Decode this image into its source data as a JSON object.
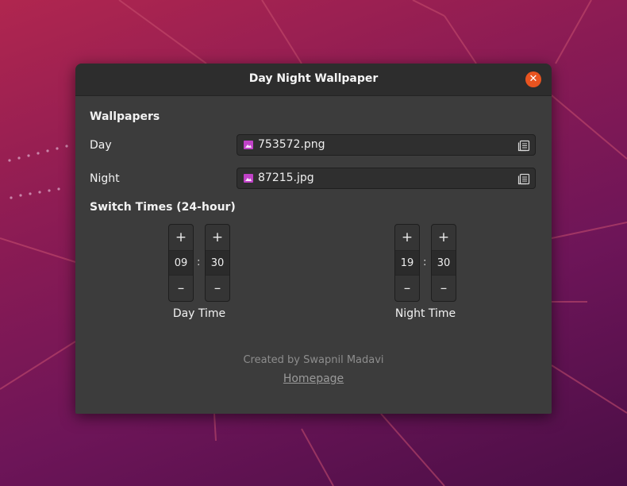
{
  "window": {
    "title": "Day Night Wallpaper"
  },
  "wallpapers": {
    "heading": "Wallpapers",
    "day": {
      "label": "Day",
      "file": "753572.png"
    },
    "night": {
      "label": "Night",
      "file": "87215.jpg"
    }
  },
  "switch_times": {
    "heading": "Switch Times (24-hour)",
    "day": {
      "hour": "09",
      "minute": "30",
      "label": "Day Time"
    },
    "night": {
      "hour": "19",
      "minute": "30",
      "label": "Night Time"
    },
    "separator": ":",
    "plus": "+",
    "minus": "–"
  },
  "footer": {
    "credit": "Created by Swapnil Madavi",
    "link": "Homepage"
  },
  "colors": {
    "accent": "#e95420",
    "window_bg": "#3c3c3c",
    "titlebar_bg": "#2d2d2d",
    "file_icon": "#c042c7"
  },
  "icons": {
    "close": "close-icon",
    "image_file": "image-file-icon",
    "file_chooser": "document-open-icon"
  }
}
